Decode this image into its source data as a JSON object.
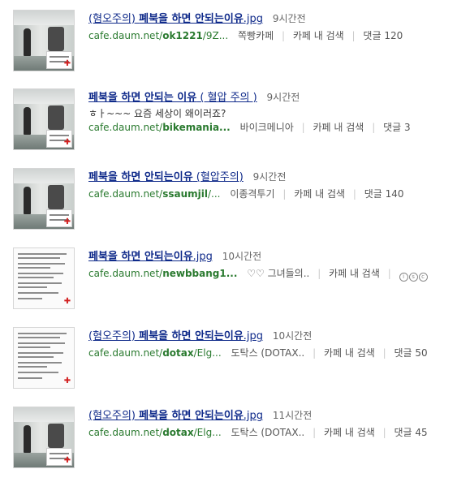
{
  "results": [
    {
      "title_prefix": "(혐오주의) ",
      "title_main": "폐북을 하면 안되는이유",
      "title_suffix": ".jpg",
      "time": "9시간전",
      "url_domain": "cafe.daum.net/",
      "url_id": "ok1221",
      "url_rest": "/9Z...",
      "source": "쪽빵카페",
      "search_label": "카페 내 검색",
      "comments": "댓글 120"
    },
    {
      "title_prefix": "",
      "title_main": "페북을 하면 안되는 이유",
      "title_suffix": " ( 혈압 주의 )",
      "time": "9시간전",
      "snippet": "ㅎㅏ~~~ 요즘 세상이 왜이러죠?",
      "url_domain": "cafe.daum.net/",
      "url_id": "bikemania...",
      "url_rest": "",
      "source": "바이크메니아",
      "search_label": "카페 내 검색",
      "comments": "댓글 3"
    },
    {
      "title_prefix": "",
      "title_main": "페북을 하면 안되는이유",
      "title_suffix": " (혈압주의)",
      "time": "9시간전",
      "url_domain": "cafe.daum.net/",
      "url_id": "ssaumjil",
      "url_rest": "/...",
      "source": "이종격투기",
      "search_label": "카페 내 검색",
      "comments": "댓글 140"
    },
    {
      "title_prefix": "",
      "title_main": "페북을 하면 안되는이유",
      "title_suffix": ".jpg",
      "time": "10시간전",
      "url_domain": "cafe.daum.net/",
      "url_id": "newbbang1...",
      "url_rest": "",
      "source": "♡♡ 그녀들의..",
      "search_label": "카페 내 검색",
      "icons": [
        "i",
        "s",
        "c"
      ]
    },
    {
      "title_prefix": "(혐오주의) ",
      "title_main": "페북을 하면 안되는이유",
      "title_suffix": ".jpg",
      "time": "10시간전",
      "url_domain": "cafe.daum.net/",
      "url_id": "dotax",
      "url_rest": "/Elg...",
      "source": "도탁스 (DOTAX..",
      "search_label": "카페 내 검색",
      "comments": "댓글 50"
    },
    {
      "title_prefix": "(혐오주의) ",
      "title_main": "페북을 하면 안되는이유",
      "title_suffix": ".jpg",
      "time": "11시간전",
      "url_domain": "cafe.daum.net/",
      "url_id": "dotax",
      "url_rest": "/Elg...",
      "source": "도탁스 (DOTAX..",
      "search_label": "카페 내 검색",
      "comments": "댓글 45"
    }
  ],
  "colors": {
    "title_link": "#0f2a8a",
    "url": "#2a7a2f",
    "meta": "#555555",
    "time": "#666666",
    "red_cross": "#d21f1f"
  },
  "thumbnails": [
    "photo",
    "photo",
    "photo",
    "text",
    "text",
    "photo"
  ]
}
